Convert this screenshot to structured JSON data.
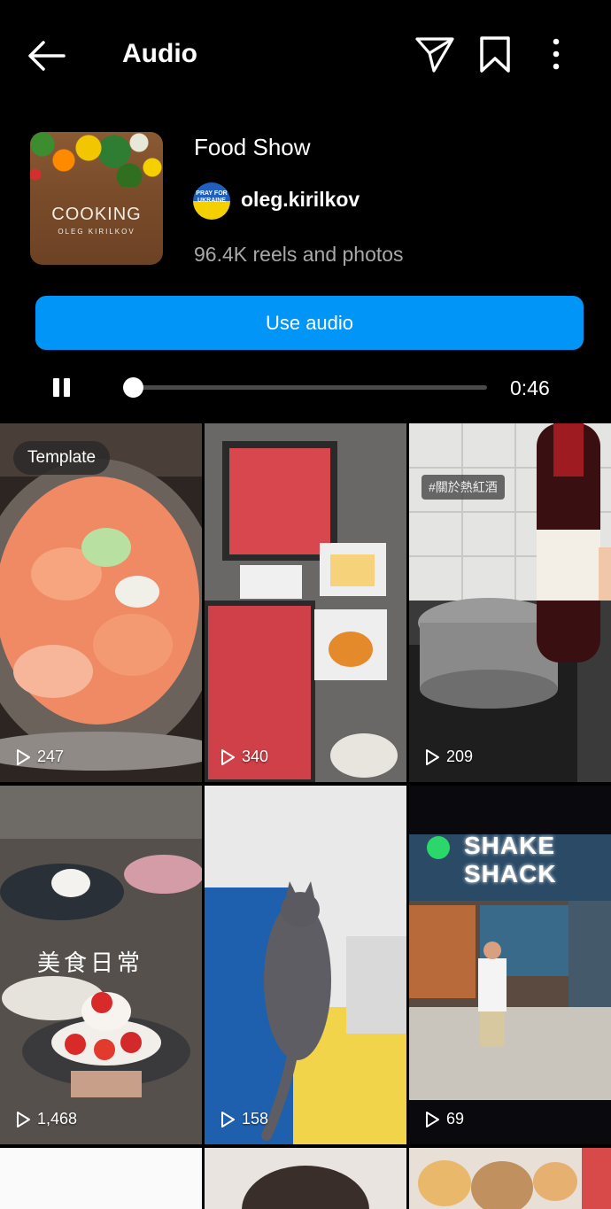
{
  "header": {
    "title": "Audio",
    "back_icon": "arrow-left-icon",
    "send_icon": "paper-plane-icon",
    "save_icon": "bookmark-icon",
    "more_icon": "more-vertical-icon"
  },
  "audio": {
    "cover": {
      "title": "COOKING",
      "subtitle": "OLEG KIRILKOV"
    },
    "name": "Food Show",
    "artist": "oleg.kirilkov",
    "avatar_text": "PRAY FOR UKRAINE",
    "reels_count": "96.4K reels and photos",
    "use_audio_label": "Use audio"
  },
  "player": {
    "state": "playing",
    "progress": 0.02,
    "time": "0:46"
  },
  "grid": [
    {
      "views": "247",
      "badge": "Template"
    },
    {
      "views": "340"
    },
    {
      "views": "209",
      "tag": "#關於熱紅酒"
    },
    {
      "views": "1,468",
      "caption": "美食日常"
    },
    {
      "views": "158"
    },
    {
      "views": "69",
      "sign": "SHAKE SHACK"
    }
  ],
  "colors": {
    "accent": "#0095f6",
    "background": "#000000",
    "secondary_text": "#a8a8a8"
  }
}
